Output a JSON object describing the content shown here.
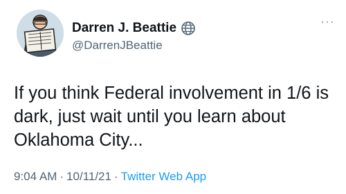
{
  "author": {
    "display_name": "Darren J. Beattie",
    "handle": "@DarrenJBeattie",
    "badge_icon": "globe-icon",
    "avatar": "cartoon-man-reading-newspaper"
  },
  "menu": {
    "label": "···"
  },
  "tweet": {
    "text": "If you think Federal involvement in 1/6 is dark, just wait until you learn about Oklahoma City..."
  },
  "meta": {
    "time": "9:04 AM",
    "separator": "·",
    "date": "10/11/21",
    "source": "Twitter Web App"
  },
  "colors": {
    "text": "#0f1419",
    "secondary": "#536471",
    "link": "#1d9bf0"
  }
}
